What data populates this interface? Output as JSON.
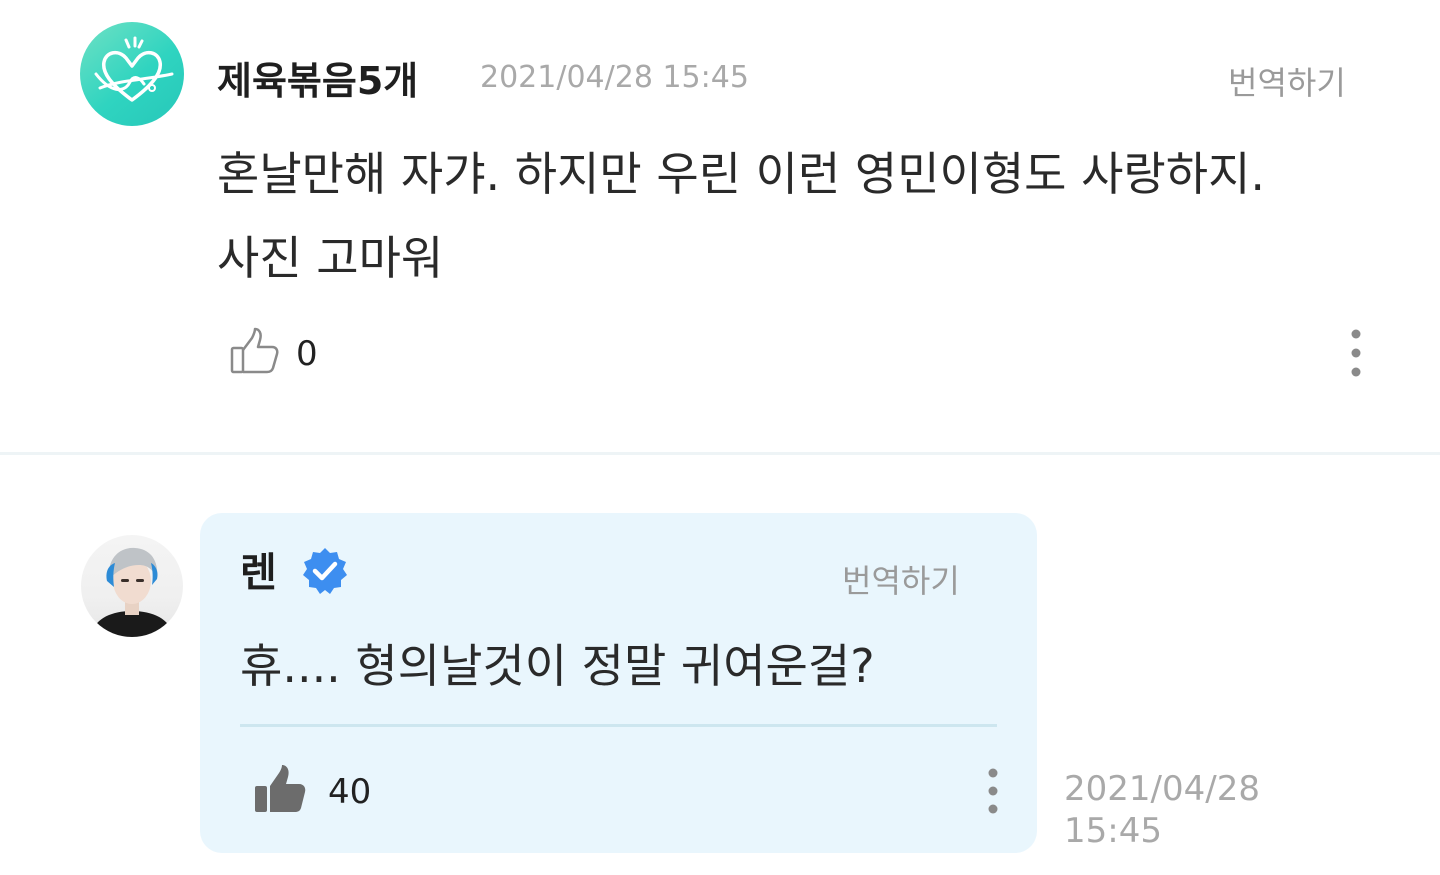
{
  "comment": {
    "author": "제육볶음5개",
    "date": "2021/04/28 15:45",
    "translate_label": "번역하기",
    "text": "혼날만해 자갸. 하지만 우린 이런 영민이형도 사랑하지. 사진 고마워",
    "like_count": "0",
    "avatar_icon": "heart-logo-avatar",
    "colors": {
      "avatar_bg": "#3fd6c2"
    }
  },
  "reply": {
    "author": "렌",
    "verified_icon": "verified-badge-icon",
    "translate_label": "번역하기",
    "text": "휴.... 형의날것이 정말 귀여운걸?",
    "like_count": "40",
    "date": "2021/04/28",
    "time": "15:45",
    "colors": {
      "bubble_bg": "#e9f6fd",
      "badge": "#3d8ef0"
    }
  }
}
